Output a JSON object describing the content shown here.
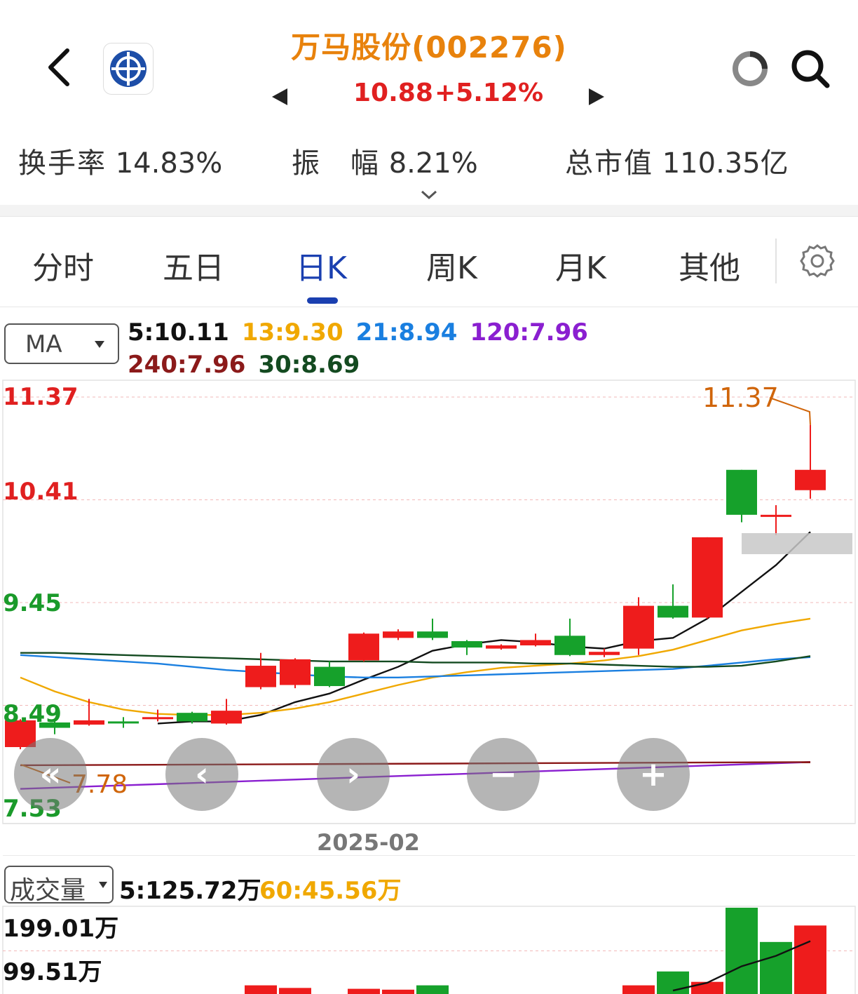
{
  "header": {
    "title": "万马股份(002276)",
    "price": "10.88",
    "change": "+5.12%"
  },
  "stats": [
    {
      "label": "换手率",
      "value": "14.83%"
    },
    {
      "label": "振　幅",
      "value": "8.21%"
    },
    {
      "label": "总市值",
      "value": "110.35亿"
    }
  ],
  "tabs": [
    "分时",
    "五日",
    "日K",
    "周K",
    "月K",
    "其他"
  ],
  "active_tab": "日K",
  "ma": {
    "select_label": "MA",
    "row1": [
      {
        "text": "5:10.11",
        "color": "#111111"
      },
      {
        "text": "13:9.30",
        "color": "#f0a800"
      },
      {
        "text": "21:8.94",
        "color": "#1a7fe0"
      },
      {
        "text": "120:7.96",
        "color": "#8a1fd0"
      }
    ],
    "row2": [
      {
        "text": "240:7.96",
        "color": "#8b1a1a"
      },
      {
        "text": "30:8.69",
        "color": "#134a20"
      }
    ]
  },
  "price_axis": {
    "labels": [
      {
        "text": "11.37",
        "color": "#e02020"
      },
      {
        "text": "10.41",
        "color": "#e02020"
      },
      {
        "text": "9.45",
        "color": "#1a9a2a"
      },
      {
        "text": "8.49",
        "color": "#1a9a2a"
      },
      {
        "text": "7.53",
        "color": "#1a9a2a"
      }
    ],
    "high_marker": "11.37",
    "low_marker": "7.78"
  },
  "date_label": "2025-02",
  "nav_buttons": [
    "«",
    "‹",
    "›",
    "−",
    "+"
  ],
  "volume": {
    "select_label": "成交量",
    "ma5": "5:125.72万",
    "ma60": "60:45.56万",
    "axis": [
      "199.01万",
      "99.51万"
    ]
  },
  "chart_data": {
    "type": "candlestick",
    "ylim": [
      7.53,
      11.37
    ],
    "up_color": "#ee1c1c",
    "down_color": "#16a12b",
    "candles": [
      {
        "o": 8.1,
        "c": 8.35,
        "h": 8.36,
        "l": 8.08
      },
      {
        "o": 8.33,
        "c": 8.28,
        "h": 8.36,
        "l": 8.22
      },
      {
        "o": 8.31,
        "c": 8.35,
        "h": 8.55,
        "l": 8.3
      },
      {
        "o": 8.34,
        "c": 8.33,
        "h": 8.38,
        "l": 8.28
      },
      {
        "o": 8.38,
        "c": 8.38,
        "h": 8.45,
        "l": 8.34
      },
      {
        "o": 8.42,
        "c": 8.34,
        "h": 8.43,
        "l": 8.32
      },
      {
        "o": 8.32,
        "c": 8.44,
        "h": 8.55,
        "l": 8.31
      },
      {
        "o": 8.66,
        "c": 8.86,
        "h": 8.98,
        "l": 8.64
      },
      {
        "o": 8.68,
        "c": 8.92,
        "h": 8.93,
        "l": 8.65
      },
      {
        "o": 8.85,
        "c": 8.67,
        "h": 8.9,
        "l": 8.66
      },
      {
        "o": 8.91,
        "c": 9.16,
        "h": 9.17,
        "l": 8.9
      },
      {
        "o": 9.12,
        "c": 9.18,
        "h": 9.2,
        "l": 9.1
      },
      {
        "o": 9.18,
        "c": 9.12,
        "h": 9.3,
        "l": 9.1
      },
      {
        "o": 9.09,
        "c": 9.03,
        "h": 9.1,
        "l": 8.96
      },
      {
        "o": 9.02,
        "c": 9.05,
        "h": 9.06,
        "l": 9.01
      },
      {
        "o": 9.05,
        "c": 9.1,
        "h": 9.16,
        "l": 9.04
      },
      {
        "o": 9.14,
        "c": 8.96,
        "h": 9.3,
        "l": 8.95
      },
      {
        "o": 8.96,
        "c": 8.99,
        "h": 9.02,
        "l": 8.94
      },
      {
        "o": 9.02,
        "c": 9.42,
        "h": 9.5,
        "l": 8.96
      },
      {
        "o": 9.42,
        "c": 9.31,
        "h": 9.62,
        "l": 9.3
      },
      {
        "o": 9.31,
        "c": 10.06,
        "h": 10.06,
        "l": 9.3
      },
      {
        "o": 10.69,
        "c": 10.27,
        "h": 10.69,
        "l": 10.2
      },
      {
        "o": 10.27,
        "c": 10.27,
        "h": 10.36,
        "l": 10.08
      },
      {
        "o": 10.5,
        "c": 10.69,
        "h": 11.11,
        "l": 10.42
      }
    ],
    "ma_lines": [
      {
        "name": "5",
        "color": "#111111",
        "values": [
          null,
          null,
          null,
          null,
          8.32,
          8.34,
          8.34,
          8.4,
          8.52,
          8.6,
          8.73,
          8.85,
          9.0,
          9.06,
          9.1,
          9.08,
          9.04,
          9.02,
          9.09,
          9.12,
          9.3,
          9.55,
          9.8,
          10.11
        ]
      },
      {
        "name": "13",
        "color": "#f0a800",
        "values": [
          8.75,
          8.62,
          8.52,
          8.45,
          8.41,
          8.4,
          8.4,
          8.42,
          8.46,
          8.52,
          8.6,
          8.68,
          8.75,
          8.8,
          8.84,
          8.86,
          8.88,
          8.91,
          8.95,
          9.01,
          9.1,
          9.19,
          9.25,
          9.3
        ]
      },
      {
        "name": "21",
        "color": "#1a7fe0",
        "values": [
          8.96,
          8.94,
          8.92,
          8.9,
          8.88,
          8.85,
          8.82,
          8.8,
          8.78,
          8.76,
          8.75,
          8.75,
          8.76,
          8.77,
          8.78,
          8.79,
          8.8,
          8.81,
          8.82,
          8.83,
          8.86,
          8.89,
          8.92,
          8.94
        ]
      },
      {
        "name": "30",
        "color": "#134a20",
        "values": [
          8.98,
          8.98,
          8.97,
          8.96,
          8.95,
          8.94,
          8.93,
          8.92,
          8.91,
          8.9,
          8.9,
          8.9,
          8.89,
          8.89,
          8.89,
          8.88,
          8.88,
          8.87,
          8.86,
          8.85,
          8.85,
          8.86,
          8.9,
          8.95
        ]
      },
      {
        "name": "120",
        "color": "#8a1fd0",
        "values": [
          7.71,
          7.72,
          7.73,
          7.74,
          7.75,
          7.76,
          7.77,
          7.78,
          7.79,
          7.8,
          7.81,
          7.82,
          7.83,
          7.84,
          7.85,
          7.86,
          7.87,
          7.88,
          7.89,
          7.9,
          7.91,
          7.92,
          7.94,
          7.96
        ]
      },
      {
        "name": "240",
        "color": "#8b1a1a",
        "values": [
          7.93,
          7.93,
          7.93,
          7.93,
          7.93,
          7.93,
          7.93,
          7.93,
          7.93,
          7.93,
          7.94,
          7.94,
          7.94,
          7.94,
          7.94,
          7.94,
          7.94,
          7.95,
          7.95,
          7.95,
          7.95,
          7.95,
          7.96,
          7.96
        ]
      }
    ],
    "volume_bars": [
      {
        "v": 0,
        "up": true
      },
      {
        "v": 0,
        "up": false
      },
      {
        "v": 0,
        "up": true
      },
      {
        "v": 0,
        "up": false
      },
      {
        "v": 0,
        "up": true
      },
      {
        "v": 0,
        "up": false
      },
      {
        "v": 0,
        "up": true
      },
      {
        "v": 20,
        "up": true
      },
      {
        "v": 14,
        "up": true
      },
      {
        "v": 0,
        "up": false
      },
      {
        "v": 12,
        "up": true
      },
      {
        "v": 10,
        "up": true
      },
      {
        "v": 20,
        "up": false
      },
      {
        "v": 0,
        "up": false
      },
      {
        "v": 0,
        "up": true
      },
      {
        "v": 0,
        "up": true
      },
      {
        "v": 0,
        "up": false
      },
      {
        "v": 0,
        "up": true
      },
      {
        "v": 20,
        "up": true
      },
      {
        "v": 52,
        "up": false
      },
      {
        "v": 28,
        "up": true
      },
      {
        "v": 199,
        "up": false
      },
      {
        "v": 120,
        "up": false
      },
      {
        "v": 158,
        "up": true
      }
    ],
    "volume_ma5": [
      null,
      null,
      null,
      null,
      null,
      null,
      null,
      null,
      null,
      null,
      null,
      null,
      null,
      null,
      null,
      null,
      null,
      null,
      null,
      8,
      26,
      64,
      88,
      122
    ],
    "volume_ylim": [
      0,
      199.01
    ]
  }
}
